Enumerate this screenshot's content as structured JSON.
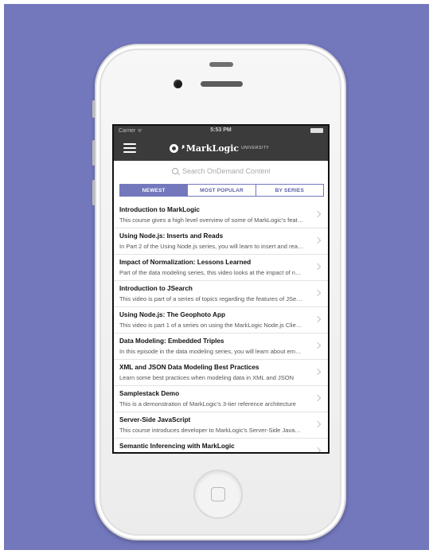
{
  "status_bar": {
    "carrier": "Carrier ᯤ",
    "time": "5:53 PM"
  },
  "header": {
    "logo_name": "MarkLogic",
    "logo_sub": "UNIVERSITY",
    "logo_dots": "▪▘"
  },
  "search": {
    "placeholder": "Search OnDemand Content..."
  },
  "tabs": [
    {
      "label": "NEWEST",
      "active": true
    },
    {
      "label": "MOST POPULAR",
      "active": false
    },
    {
      "label": "BY SERIES",
      "active": false
    }
  ],
  "items": [
    {
      "title": "Introduction to MarkLogic",
      "description": "This course gives a high level overview of some of MarkLogic's features"
    },
    {
      "title": "Using Node.js: Inserts and Reads",
      "description": "In Part 2 of the Using Node.js series, you will learn to insert and read documents"
    },
    {
      "title": "Impact of Normalization: Lessons Learned",
      "description": "Part of the data modeling series, this video looks at the impact of normalization"
    },
    {
      "title": "Introduction to JSearch",
      "description": "This video is part of a series of topics regarding the features of JSearch"
    },
    {
      "title": "Using Node.js: The Geophoto App",
      "description": "This video is part 1 of a series on using the MarkLogic Node.js Client API"
    },
    {
      "title": "Data Modeling: Embedded Triples",
      "description": "In this episode in the data modeling series, you will learn about embedded triples"
    },
    {
      "title": "XML and JSON Data Modeling Best Practices",
      "description": "Learn some best practices when modeling data in XML and JSON"
    },
    {
      "title": "Samplestack Demo",
      "description": "This is a demonstration of MarkLogic's 3-tier reference architecture"
    },
    {
      "title": "Server-Side JavaScript",
      "description": "This course introduces developer to MarkLogic's Server-Side JavaScript"
    },
    {
      "title": "Semantic Inferencing with MarkLogic",
      "description": ""
    }
  ]
}
